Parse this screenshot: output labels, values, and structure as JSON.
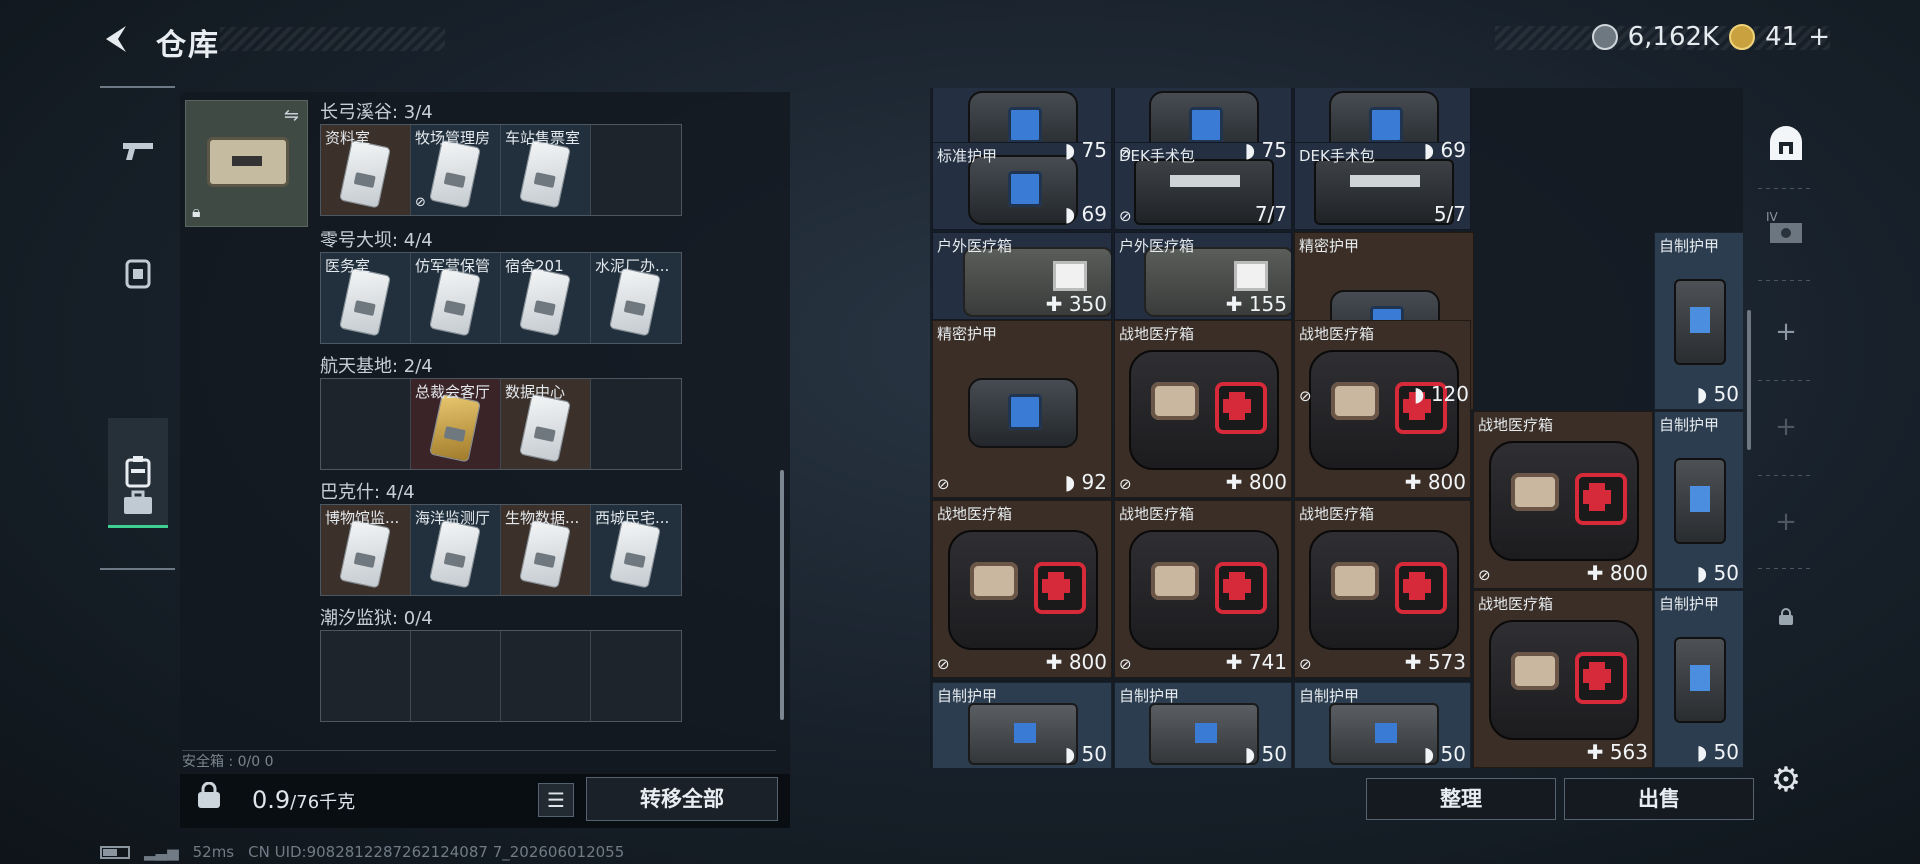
{
  "header": {
    "title": "仓库",
    "currency": "6,162K",
    "tickets": "41",
    "tickets_suffix": "+"
  },
  "left_nav": {
    "items": [
      "gun-icon",
      "armor-icon",
      "case-icon",
      "briefcase-icon"
    ],
    "active": "case-icon"
  },
  "key_case": {
    "swap_icon": "swap-icon",
    "lock_icon": "lock-icon"
  },
  "regions": [
    {
      "label": "长弓溪谷: 3/4",
      "slots": [
        {
          "name": "资料室",
          "bg": "brown",
          "no_loot": false
        },
        {
          "name": "牧场管理房",
          "bg": "blue",
          "no_loot": true
        },
        {
          "name": "车站售票室",
          "bg": "blue",
          "no_loot": false
        },
        {
          "name": "",
          "bg": "empty",
          "no_loot": false
        }
      ]
    },
    {
      "label": "零号大坝: 4/4",
      "slots": [
        {
          "name": "医务室",
          "bg": "blue",
          "no_loot": false
        },
        {
          "name": "仿军营保管",
          "bg": "blue",
          "no_loot": false
        },
        {
          "name": "宿舍201",
          "bg": "blue",
          "no_loot": false
        },
        {
          "name": "水泥厂办...",
          "bg": "blue",
          "no_loot": false
        }
      ]
    },
    {
      "label": "航天基地: 2/4",
      "slots": [
        {
          "name": "",
          "bg": "empty",
          "no_loot": false
        },
        {
          "name": "总裁会客厅",
          "bg": "red",
          "no_loot": false,
          "gold": true
        },
        {
          "name": "数据中心",
          "bg": "brown",
          "no_loot": false
        },
        {
          "name": "",
          "bg": "empty",
          "no_loot": false
        }
      ]
    },
    {
      "label": "巴克什: 4/4",
      "slots": [
        {
          "name": "博物馆监...",
          "bg": "brown",
          "no_loot": false
        },
        {
          "name": "海洋监测厅",
          "bg": "blue",
          "no_loot": false
        },
        {
          "name": "生物数据...",
          "bg": "brown",
          "no_loot": false
        },
        {
          "name": "西城民宅...",
          "bg": "blue",
          "no_loot": false
        }
      ]
    },
    {
      "label": "潮汐监狱: 0/4",
      "slots": [
        {
          "name": "",
          "bg": "empty"
        },
        {
          "name": "",
          "bg": "empty"
        },
        {
          "name": "",
          "bg": "empty"
        },
        {
          "name": "",
          "bg": "empty"
        }
      ]
    }
  ],
  "safebox_label": "安全箱 : 0/0  0",
  "weight": {
    "value": "0.9",
    "unit": "/76千克"
  },
  "buttons": {
    "transfer_all": "转移全部",
    "sort": "整理",
    "sell": "出售"
  },
  "stash_items": [
    {
      "name": "",
      "value": "◗ 75",
      "type": "vest",
      "bg": "blue",
      "lock": false,
      "col": 0,
      "row": 0,
      "w": 1,
      "h": 1
    },
    {
      "name": "",
      "value": "◗ 75",
      "type": "vest",
      "bg": "blue",
      "lock": true,
      "col": 1,
      "row": 0,
      "w": 1,
      "h": 1
    },
    {
      "name": "",
      "value": "◗ 69",
      "type": "vest",
      "bg": "blue",
      "lock": false,
      "col": 2,
      "row": 0,
      "w": 1,
      "h": 1
    },
    {
      "name": "标准护甲",
      "value": "◗ 69",
      "type": "vest",
      "bg": "blue",
      "lock": false,
      "col": 0,
      "row": 1,
      "w": 1,
      "h": 1
    },
    {
      "name": "DEK手术包",
      "value": "7/7",
      "type": "pack",
      "bg": "blue",
      "lock": true,
      "col": 1,
      "row": 1,
      "w": 1,
      "h": 1
    },
    {
      "name": "DEK手术包",
      "value": "5/7",
      "type": "pack",
      "bg": "blue",
      "lock": false,
      "col": 2,
      "row": 1,
      "w": 1,
      "h": 1
    },
    {
      "name": "户外医疗箱",
      "value": "✚ 350",
      "type": "bag",
      "bg": "blue",
      "lock": false,
      "col": 0,
      "row": 2,
      "w": 1,
      "h": 1
    },
    {
      "name": "户外医疗箱",
      "value": "✚ 155",
      "type": "bag",
      "bg": "blue",
      "lock": false,
      "col": 1,
      "row": 2,
      "w": 1,
      "h": 1
    },
    {
      "name": "精密护甲",
      "value": "◗ 120",
      "type": "vest",
      "bg": "brown",
      "lock": true,
      "col": 2,
      "row": 2,
      "w": 2,
      "h": 2
    },
    {
      "name": "自制护甲",
      "value": "◗ 50",
      "type": "smallvest",
      "bg": "steel",
      "lock": false,
      "col": 3,
      "row": 2,
      "w": 1,
      "h": 2
    },
    {
      "name": "精密护甲",
      "value": "◗ 92",
      "type": "vest",
      "bg": "brown",
      "lock": true,
      "col": 0,
      "row": 3,
      "w": 1,
      "h": 2
    },
    {
      "name": "战地医疗箱",
      "value": "✚ 800",
      "type": "kit",
      "bg": "brown",
      "lock": true,
      "col": 1,
      "row": 3,
      "w": 1,
      "h": 2
    },
    {
      "name": "战地医疗箱",
      "value": "✚ 800",
      "type": "kit",
      "bg": "brown",
      "lock": false,
      "col": 2,
      "row": 3,
      "w": 1,
      "h": 2
    },
    {
      "name": "战地医疗箱",
      "value": "✚ 800",
      "type": "kit",
      "bg": "brown",
      "lock": true,
      "col": 3,
      "row": 4,
      "w": 2,
      "h": 2
    },
    {
      "name": "自制护甲",
      "value": "◗ 50",
      "type": "smallvest",
      "bg": "steel",
      "lock": false,
      "col": 4,
      "row": 4,
      "w": 1,
      "h": 2
    },
    {
      "name": "战地医疗箱",
      "value": "✚ 800",
      "type": "kit",
      "bg": "brown",
      "lock": true,
      "col": 0,
      "row": 5,
      "w": 1,
      "h": 2
    },
    {
      "name": "战地医疗箱",
      "value": "✚ 741",
      "type": "kit",
      "bg": "brown",
      "lock": true,
      "col": 1,
      "row": 5,
      "w": 1,
      "h": 2
    },
    {
      "name": "战地医疗箱",
      "value": "✚ 573",
      "type": "kit",
      "bg": "brown",
      "lock": true,
      "col": 2,
      "row": 5,
      "w": 1,
      "h": 2
    },
    {
      "name": "战地医疗箱",
      "value": "✚ 563",
      "type": "kit",
      "bg": "brown",
      "lock": false,
      "col": 3,
      "row": 6,
      "w": 2,
      "h": 2
    },
    {
      "name": "自制护甲",
      "value": "◗ 50",
      "type": "smallvest",
      "bg": "steel",
      "lock": false,
      "col": 4,
      "row": 6,
      "w": 1,
      "h": 2
    },
    {
      "name": "自制护甲",
      "value": "◗ 50",
      "type": "bundle",
      "bg": "steel",
      "lock": false,
      "col": 0,
      "row": 7,
      "w": 1,
      "h": 1
    },
    {
      "name": "自制护甲",
      "value": "◗ 50",
      "type": "bundle",
      "bg": "steel",
      "lock": false,
      "col": 1,
      "row": 7,
      "w": 1,
      "h": 1
    },
    {
      "name": "自制护甲",
      "value": "◗ 50",
      "type": "bundle",
      "bg": "steel",
      "lock": false,
      "col": 2,
      "row": 7,
      "w": 1,
      "h": 1
    }
  ],
  "right_bar": {
    "items": [
      "stash-icon",
      "expand-icon",
      "add-icon",
      "add-icon",
      "add-icon",
      "lock-icon"
    ],
    "expand_label": "IV"
  },
  "status": {
    "ping": "52ms",
    "uid": "CN UID:9082812287262124087 7_202606012055"
  }
}
